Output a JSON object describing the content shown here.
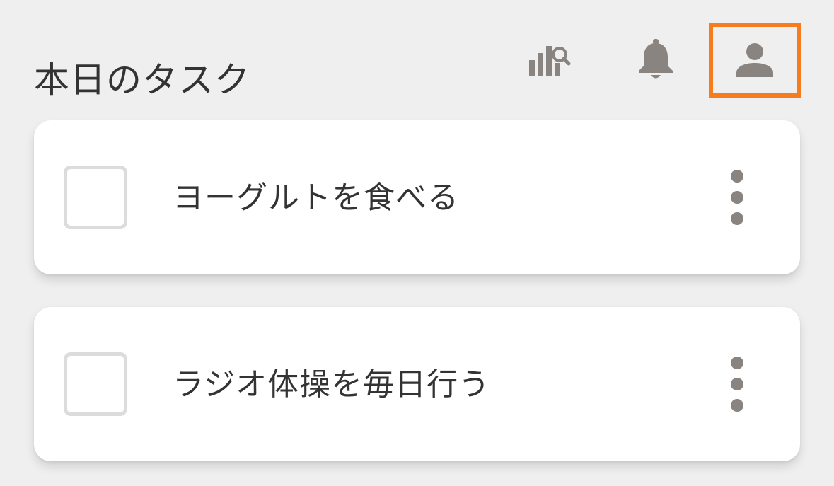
{
  "header": {
    "title": "本日のタスク",
    "icons": {
      "stats": "chart-search-icon",
      "notifications": "bell-icon",
      "profile": "person-icon"
    },
    "highlight_color": "#f57c1f",
    "icon_color": "#8a8481"
  },
  "tasks": [
    {
      "label": "ヨーグルトを食べる",
      "checked": false
    },
    {
      "label": "ラジオ体操を毎日行う",
      "checked": false
    }
  ]
}
